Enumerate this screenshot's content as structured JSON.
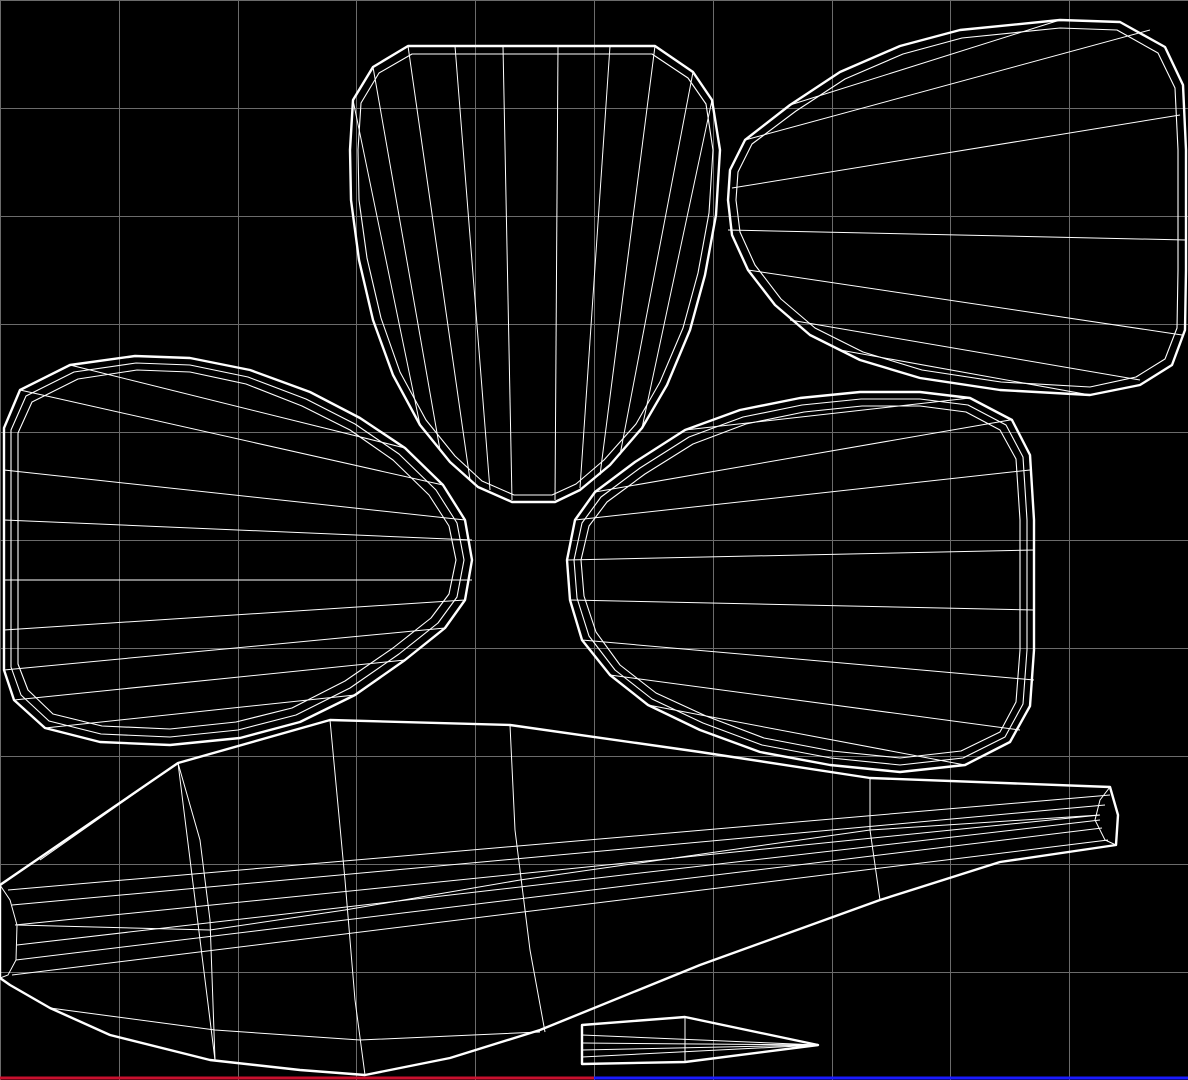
{
  "viewport": {
    "name": "uv-editor-viewport",
    "background_color": "#000000",
    "grid_color": "#6b6b6b",
    "wire_color": "#ffffff",
    "u_axis_color": "#c8102e",
    "v_axis_color": "#1a1aff",
    "grid_divisions": 10
  },
  "islands": [
    {
      "name": "uv-island-petal-top"
    },
    {
      "name": "uv-island-petal-upper-right"
    },
    {
      "name": "uv-island-petal-left"
    },
    {
      "name": "uv-island-petal-right"
    },
    {
      "name": "uv-island-body"
    },
    {
      "name": "uv-island-small-fin"
    }
  ]
}
